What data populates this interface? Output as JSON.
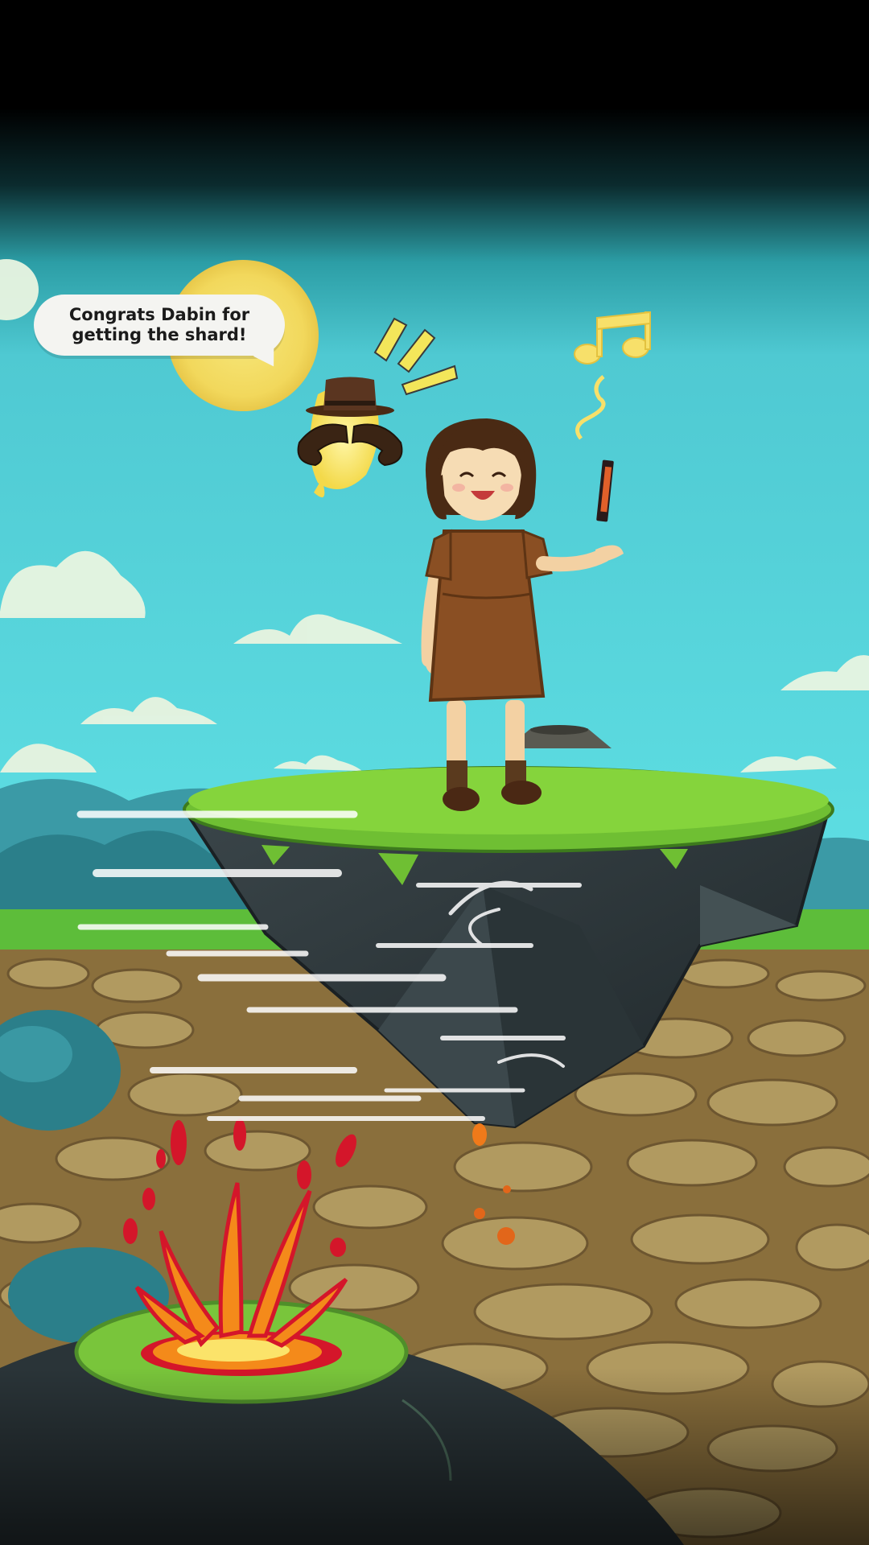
{
  "speech_bubble": {
    "text": "Congrats Dabin for\ngetting the shard!"
  },
  "characters": {
    "player": "girl-in-brown-dress",
    "companion": "hat-mustache-spirit-icon"
  },
  "held_item": "shard-icon",
  "colors": {
    "sky": "#5ad9df",
    "sky_top": "#0a2a2c",
    "grass": "#7ccd3a",
    "rock": "#2f3a3e",
    "ground": "#a58a52",
    "lava_red": "#d4162a",
    "lava_orange": "#f48a1a",
    "sun": "#f4dd6a"
  }
}
